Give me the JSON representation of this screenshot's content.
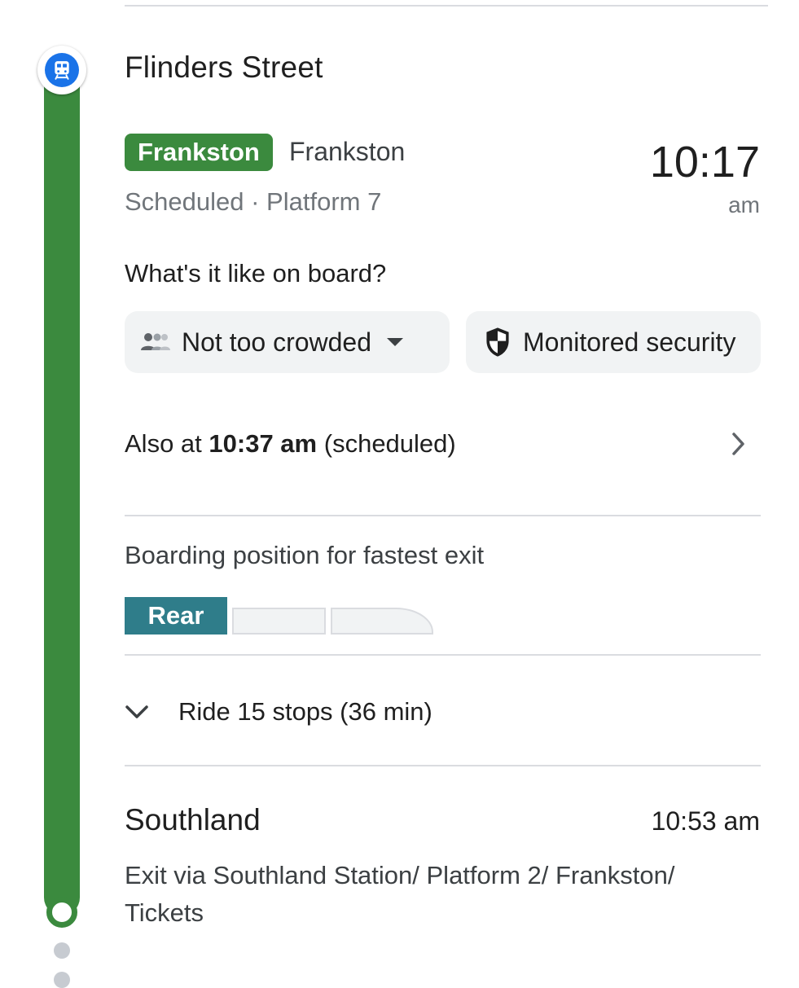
{
  "origin": {
    "station_name": "Flinders Street",
    "line_badge": "Frankston",
    "line_color": "#3b8a3e",
    "headsign": "Frankston",
    "status": "Scheduled · Platform 7",
    "departure_time": "10:17",
    "departure_ampm": "am",
    "icon": "train-icon"
  },
  "onboard": {
    "question": "What's it like on board?",
    "chips": [
      {
        "label": "Not too crowded",
        "icon": "people-icon",
        "has_dropdown": true
      },
      {
        "label": "Monitored security",
        "icon": "shield-icon"
      }
    ]
  },
  "also": {
    "prefix": "Also at",
    "time": "10:37 am",
    "suffix": "(scheduled)"
  },
  "boarding": {
    "label": "Boarding position for fastest exit",
    "highlight": "Rear",
    "highlight_color": "#2f7d8a"
  },
  "ride": {
    "label": "Ride 15 stops (36 min)"
  },
  "destination": {
    "station_name": "Southland",
    "arrival_time": "10:53 am",
    "exit_info": "Exit via Southland Station/ Platform 2/ Frankston/ Tickets"
  }
}
